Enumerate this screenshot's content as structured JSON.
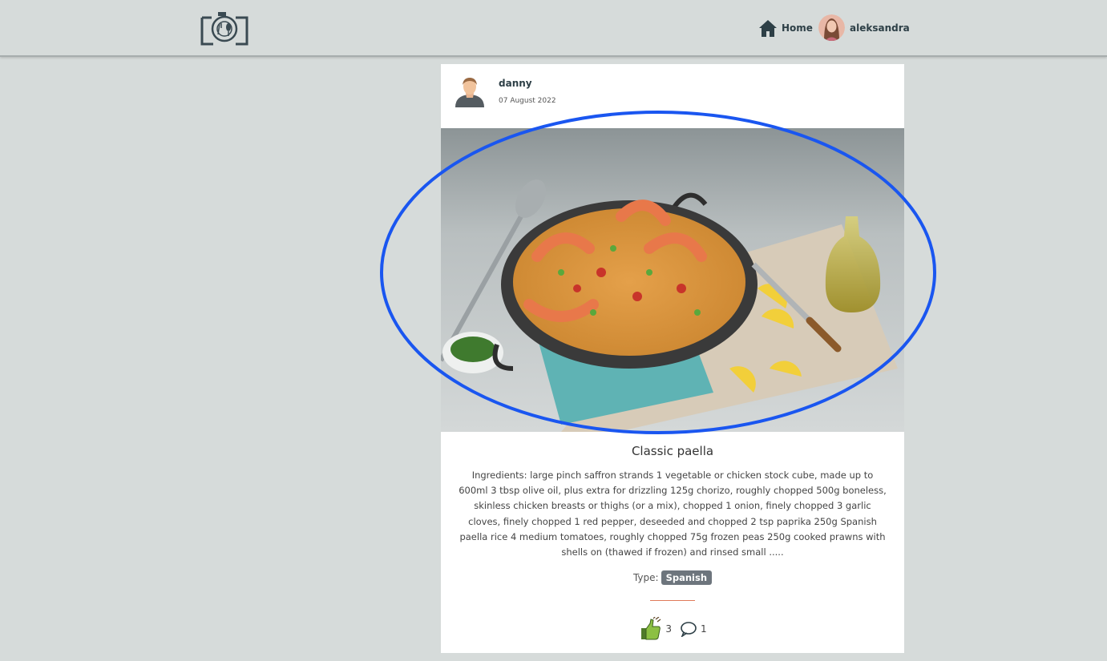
{
  "navbar": {
    "logo_icon": "camera-plate-logo-icon",
    "home_icon": "home-icon",
    "home_label": "Home",
    "user_avatar_icon": "user-avatar",
    "user_name": "aleksandra"
  },
  "post": {
    "author": "danny",
    "date": "07 August 2022",
    "image_icon": "paella-photo",
    "title": "Classic paella",
    "description": "Ingredients: large pinch saffron strands 1 vegetable or chicken stock cube, made up to 600ml 3 tbsp olive oil, plus extra for drizzling 125g chorizo, roughly chopped 500g boneless, skinless chicken breasts or thighs (or a mix), chopped 1 onion, finely chopped 3 garlic cloves, finely chopped 1 red pepper, deseeded and chopped 2 tsp paprika 250g Spanish paella rice 4 medium tomatoes, roughly chopped 75g frozen peas 250g cooked prawns with shells on (thawed if frozen) and rinsed small .....",
    "type_label": "Type:",
    "type_value": "Spanish",
    "likes": "3",
    "comments": "1",
    "like_icon": "thumbs-up-fork-icon",
    "comment_icon": "comment-icon"
  },
  "colors": {
    "background": "#d6dbda",
    "card": "#ffffff",
    "badge": "#6d757d",
    "divider": "#e07b5a",
    "annotation_ellipse": "#1a56f0"
  }
}
